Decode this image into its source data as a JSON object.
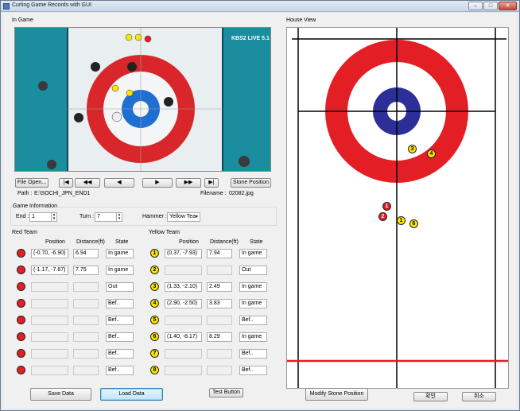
{
  "window": {
    "title": "Curling Game Records with GUI"
  },
  "in_game": {
    "title": "In Game",
    "broadcast_logo": "KBS2 LIVE 5.1",
    "buttons": {
      "file_open": "File Open...",
      "first": "|◀",
      "rewind": "◀◀",
      "prev": "◀",
      "play": "▶",
      "forward": "▶▶",
      "last": "▶|",
      "stone_position": "Stone Position"
    },
    "path_label": "Path :",
    "path_value": "E:\\SOCHI_JPN_END1",
    "filename_label": "Filename :",
    "filename_value": "02082.jpg"
  },
  "game_info": {
    "title": "Game Information",
    "end_label": "End :",
    "end_value": "1",
    "turn_label": "Turn :",
    "turn_value": "7",
    "hammer_label": "Hammer :",
    "hammer_value": "Yellow Tea"
  },
  "red_team": {
    "title": "Red Team",
    "headers": {
      "position": "Position",
      "distance": "Distance(ft)",
      "state": "State"
    },
    "rows": [
      {
        "n": "",
        "position": "(-0.70, -6.90)",
        "distance": "6.94",
        "state": "In game"
      },
      {
        "n": "",
        "position": "(-1.17, -7.67)",
        "distance": "7.75",
        "state": "In game"
      },
      {
        "n": "",
        "position": "",
        "distance": "",
        "state": "Out"
      },
      {
        "n": "",
        "position": "",
        "distance": "",
        "state": "Bef.."
      },
      {
        "n": "",
        "position": "",
        "distance": "",
        "state": "Bef.."
      },
      {
        "n": "",
        "position": "",
        "distance": "",
        "state": "Bef.."
      },
      {
        "n": "",
        "position": "",
        "distance": "",
        "state": "Bef.."
      },
      {
        "n": "",
        "position": "",
        "distance": "",
        "state": "Bef.."
      }
    ]
  },
  "yellow_team": {
    "title": "Yellow Team",
    "headers": {
      "position": "Position",
      "distance": "Distance(ft)",
      "state": "State"
    },
    "rows": [
      {
        "n": "1",
        "position": "(0.37, -7.93)",
        "distance": "7.94",
        "state": "In game"
      },
      {
        "n": "2",
        "position": "",
        "distance": "",
        "state": "Out"
      },
      {
        "n": "3",
        "position": "(1.33, -2.10)",
        "distance": "2.49",
        "state": "In game"
      },
      {
        "n": "4",
        "position": "(2.90, -2.50)",
        "distance": "3.83",
        "state": "In game"
      },
      {
        "n": "5",
        "position": "",
        "distance": "",
        "state": "Bef.."
      },
      {
        "n": "6",
        "position": "(1.40, -8.17)",
        "distance": "8.29",
        "state": "In game"
      },
      {
        "n": "7",
        "position": "",
        "distance": "",
        "state": "Bef.."
      },
      {
        "n": "8",
        "position": "",
        "distance": "",
        "state": "Bef.."
      }
    ]
  },
  "house_view": {
    "title": "House View",
    "stones": [
      {
        "team": "yellow",
        "n": "3"
      },
      {
        "team": "yellow",
        "n": "4"
      },
      {
        "team": "red",
        "n": "1"
      },
      {
        "team": "red",
        "n": "2"
      },
      {
        "team": "yellow",
        "n": "1"
      },
      {
        "team": "yellow",
        "n": "6"
      }
    ]
  },
  "bottom": {
    "save": "Save Data",
    "load": "Load Data",
    "test": "Test Button",
    "modify": "Modify Stone Position",
    "ok": "확인",
    "cancel": "취소"
  },
  "colors": {
    "house_red": "#e31e24",
    "house_blue": "#2b2f97",
    "ice": "#1a8d9e"
  }
}
